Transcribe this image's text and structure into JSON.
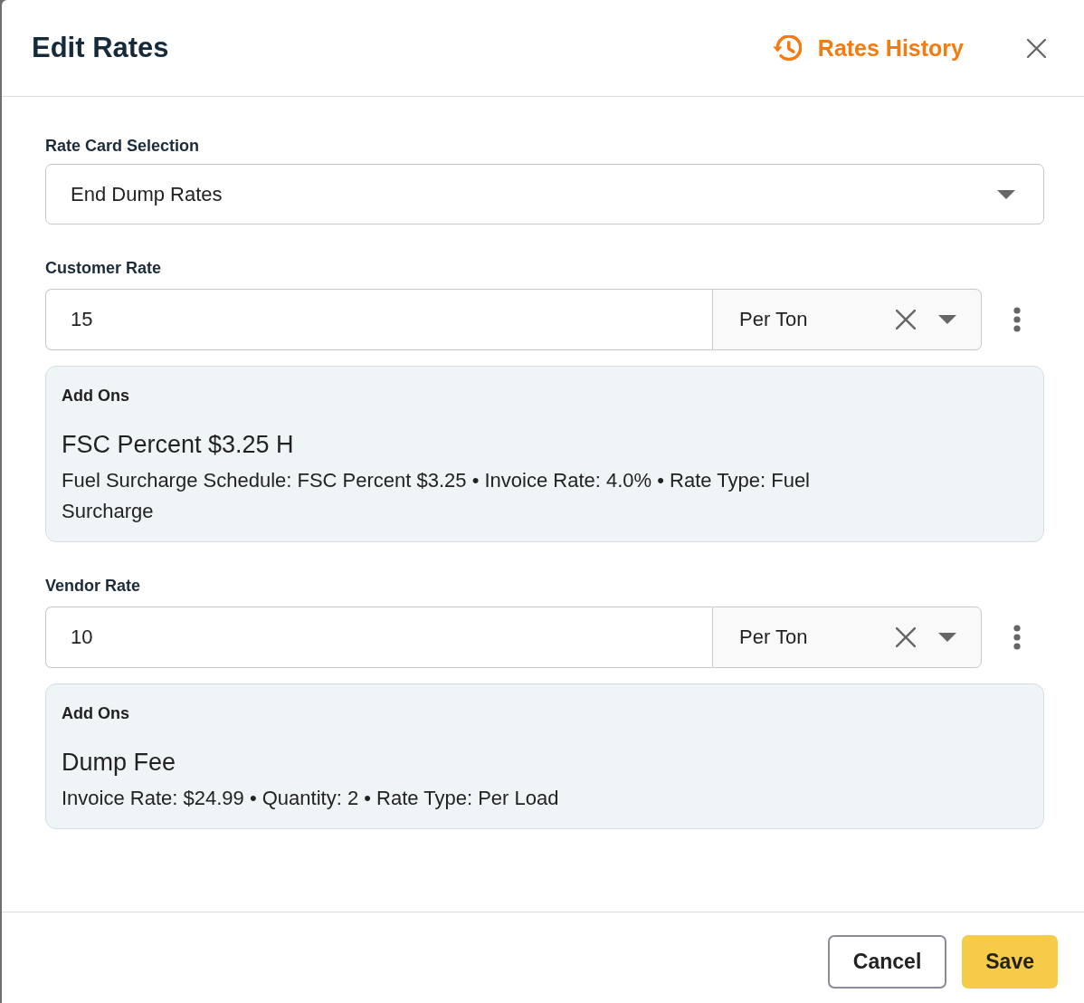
{
  "dialog": {
    "title": "Edit Rates",
    "history_link": "Rates History"
  },
  "rate_card": {
    "label": "Rate Card Selection",
    "value": "End Dump Rates"
  },
  "rates": [
    {
      "label": "Customer Rate",
      "amount": "15",
      "unit": "Per Ton",
      "add_ons": {
        "heading": "Add Ons",
        "items": [
          {
            "name": "FSC Percent $3.25 H",
            "details": "Fuel Surcharge Schedule: FSC Percent $3.25 • Invoice Rate: 4.0% • Rate Type: Fuel Surcharge"
          }
        ]
      }
    },
    {
      "label": "Vendor Rate",
      "amount": "10",
      "unit": "Per Ton",
      "add_ons": {
        "heading": "Add Ons",
        "items": [
          {
            "name": "Dump Fee",
            "details": "Invoice Rate: $24.99 • Quantity: 2 • Rate Type: Per Load"
          }
        ]
      }
    }
  ],
  "buttons": [
    {
      "label": "Cancel",
      "kind": "secondary"
    },
    {
      "label": "Save",
      "kind": "primary"
    }
  ]
}
